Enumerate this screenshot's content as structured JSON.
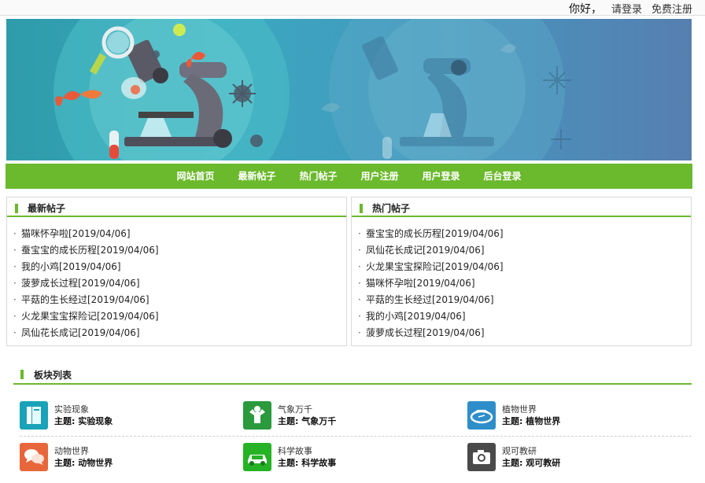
{
  "topbar": {
    "greeting": "你好，",
    "login": "请登录",
    "register": "免费注册"
  },
  "nav": {
    "items": [
      "网站首页",
      "最新帖子",
      "热门帖子",
      "用户注册",
      "用户登录",
      "后台登录"
    ]
  },
  "latest": {
    "title": "最新帖子",
    "items": [
      "猫咪怀孕啦[2019/04/06]",
      "蚕宝宝的成长历程[2019/04/06]",
      "我的小鸡[2019/04/06]",
      "菠萝成长过程[2019/04/06]",
      "平菇的生长经过[2019/04/06]",
      "火龙果宝宝探险记[2019/04/06]",
      "凤仙花长成记[2019/04/06]"
    ]
  },
  "hot": {
    "title": "热门帖子",
    "items": [
      "蚕宝宝的成长历程[2019/04/06]",
      "凤仙花长成记[2019/04/06]",
      "火龙果宝宝探险记[2019/04/06]",
      "猫咪怀孕啦[2019/04/06]",
      "平菇的生长经过[2019/04/06]",
      "我的小鸡[2019/04/06]",
      "菠萝成长过程[2019/04/06]"
    ]
  },
  "boards": {
    "title": "板块列表",
    "items": [
      {
        "name": "实验现象",
        "topic": "主题: 实验现象",
        "icon": "book-icon",
        "color": "#1aa3b8"
      },
      {
        "name": "气象万千",
        "topic": "主题: 气象万千",
        "icon": "strongman-icon",
        "color": "#2a9a3c"
      },
      {
        "name": "植物世界",
        "topic": "主题: 植物世界",
        "icon": "stadium-icon",
        "color": "#2e8ec9"
      },
      {
        "name": "动物世界",
        "topic": "主题: 动物世界",
        "icon": "chat-bubbles-icon",
        "color": "#e8673a"
      },
      {
        "name": "科学故事",
        "topic": "主题: 科学故事",
        "icon": "car-icon",
        "color": "#25b325"
      },
      {
        "name": "观可教研",
        "topic": "主题: 观可教研",
        "icon": "camera-icon",
        "color": "#4a4a4a"
      }
    ]
  }
}
